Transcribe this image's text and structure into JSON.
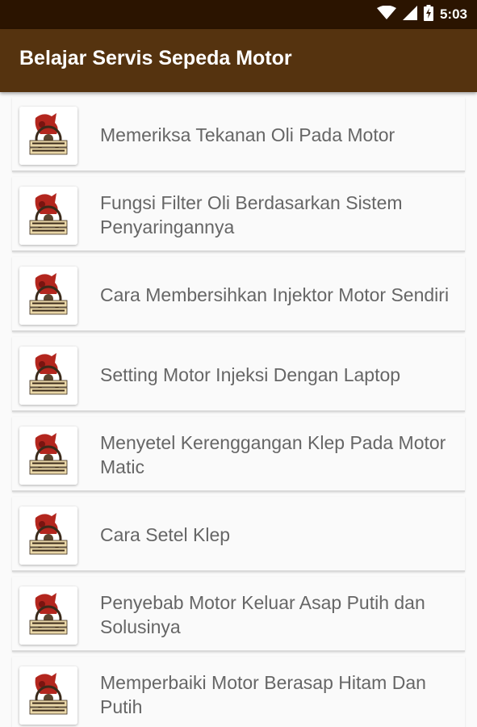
{
  "status_bar": {
    "time": "5:03",
    "icons": [
      "wifi-icon",
      "signal-icon",
      "battery-charging-icon"
    ]
  },
  "app_bar": {
    "title": "Belajar Servis Sepeda Motor"
  },
  "colors": {
    "status_bar": "#2b1400",
    "app_bar": "#55330f",
    "background": "#fafafa",
    "item_text": "#666666"
  },
  "articles": [
    {
      "title": "Memeriksa Tekanan Oli Pada Motor",
      "thumbnail": "belajar-servis-logo"
    },
    {
      "title": "Fungsi Filter Oli Berdasarkan Sistem Penyaringannya",
      "thumbnail": "belajar-servis-logo"
    },
    {
      "title": "Cara Membersihkan Injektor Motor Sendiri",
      "thumbnail": "belajar-servis-logo"
    },
    {
      "title": "Setting Motor Injeksi Dengan Laptop",
      "thumbnail": "belajar-servis-logo"
    },
    {
      "title": "Menyetel Kerenggangan Klep Pada Motor Matic",
      "thumbnail": "belajar-servis-logo"
    },
    {
      "title": "Cara Setel Klep",
      "thumbnail": "belajar-servis-logo"
    },
    {
      "title": "Penyebab Motor Keluar Asap Putih dan Solusinya",
      "thumbnail": "belajar-servis-logo"
    },
    {
      "title": "Memperbaiki Motor Berasap Hitam Dan Putih",
      "thumbnail": "belajar-servis-logo"
    }
  ]
}
